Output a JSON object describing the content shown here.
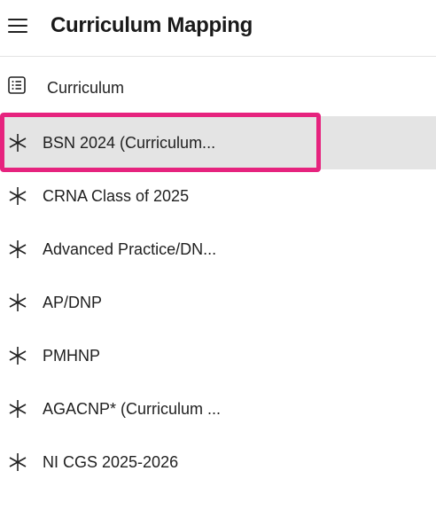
{
  "header": {
    "title": "Curriculum Mapping",
    "menu_icon": "hamburger-menu-icon"
  },
  "curriculum_link": {
    "label": "Curriculum",
    "icon": "list-icon"
  },
  "nav_items": [
    {
      "label": "BSN 2024 (Curriculum...",
      "icon": "asterisk-icon",
      "selected": true
    },
    {
      "label": "CRNA Class of 2025",
      "icon": "asterisk-icon",
      "selected": false
    },
    {
      "label": "Advanced Practice/DN...",
      "icon": "asterisk-icon",
      "selected": false
    },
    {
      "label": "AP/DNP",
      "icon": "asterisk-icon",
      "selected": false
    },
    {
      "label": "PMHNP",
      "icon": "asterisk-icon",
      "selected": false
    },
    {
      "label": "AGACNP* (Curriculum ...",
      "icon": "asterisk-icon",
      "selected": false
    },
    {
      "label": "NI CGS 2025-2026",
      "icon": "asterisk-icon",
      "selected": false
    }
  ],
  "colors": {
    "highlight": "#e6237e",
    "selected_background": "#e4e4e4"
  }
}
